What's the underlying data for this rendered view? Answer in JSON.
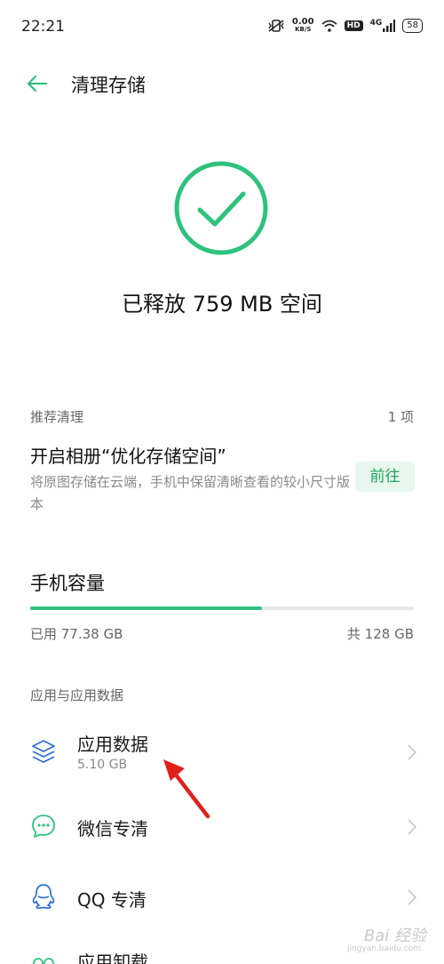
{
  "status_bar": {
    "time": "22:21",
    "net_speed": "0.00",
    "net_unit": "KB/S",
    "hd": "HD",
    "signal_label": "4G",
    "battery": "58"
  },
  "header": {
    "title": "清理存储"
  },
  "result": {
    "freed_text": "已释放 759 MB 空间",
    "accent_color": "#2ec27e"
  },
  "recommend": {
    "section_label": "推荐清理",
    "count": "1 项",
    "item_title": "开启相册“优化存储空间”",
    "item_desc": "将原图存储在云端，手机中保留清晰查看的较小尺寸版本",
    "action_label": "前往"
  },
  "capacity": {
    "title": "手机容量",
    "used": "已用 77.38 GB",
    "total": "共 128 GB",
    "used_fraction": 0.6045
  },
  "apps": {
    "section_label": "应用与应用数据",
    "items": [
      {
        "icon": "layers-icon",
        "title": "应用数据",
        "subtitle": "5.10 GB"
      },
      {
        "icon": "chat-bubble-icon",
        "title": "微信专清"
      },
      {
        "icon": "penguin-icon",
        "title": "QQ 专清"
      },
      {
        "icon": "apps-icon",
        "title": "应用卸载"
      }
    ]
  },
  "watermark": {
    "text": "Bai 经验",
    "sub": "jingyan.baidu.com"
  }
}
